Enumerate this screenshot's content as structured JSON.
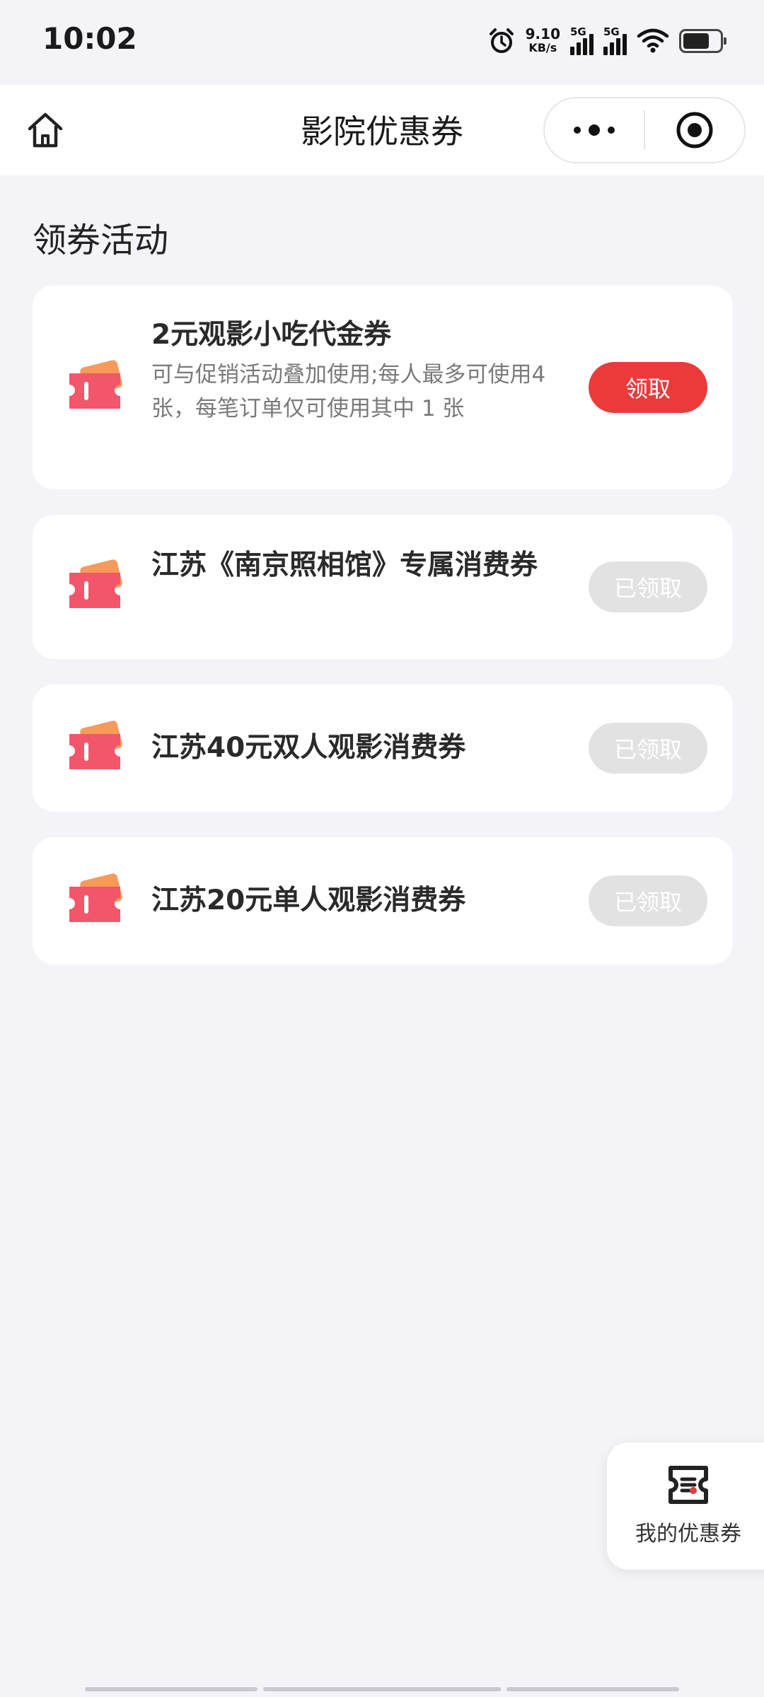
{
  "status_bar": {
    "time": "10:02",
    "speed_value": "9.10",
    "speed_unit": "KB/s",
    "signal_label_1": "5G",
    "signal_label_2": "5G"
  },
  "nav": {
    "title": "影院优惠券"
  },
  "section": {
    "title": "领券活动"
  },
  "coupons": [
    {
      "title": "2元观影小吃代金券",
      "desc": "可与促销活动叠加使用;每人最多可使用4张，每笔订单仅可使用其中 1 张",
      "button": "领取",
      "claimed": false
    },
    {
      "title": "江苏《南京照相馆》专属消费券",
      "desc": "",
      "button": "已领取",
      "claimed": true
    },
    {
      "title": "江苏40元双人观影消费券",
      "desc": "",
      "button": "已领取",
      "claimed": true
    },
    {
      "title": "江苏20元单人观影消费券",
      "desc": "",
      "button": "已领取",
      "claimed": true
    }
  ],
  "fab": {
    "label": "我的优惠券"
  },
  "colors": {
    "accent": "#ec3a3a",
    "disabled_button": "#e2e2e2",
    "page_background": "#f4f4f8",
    "ticket_front": "#f2566a",
    "ticket_back": "#f79a5a"
  },
  "icons": {
    "home": "home-icon",
    "more": "more-dots-icon",
    "close": "target-close-icon",
    "ticket": "ticket-icon",
    "my_coupons": "coupon-wallet-icon"
  }
}
